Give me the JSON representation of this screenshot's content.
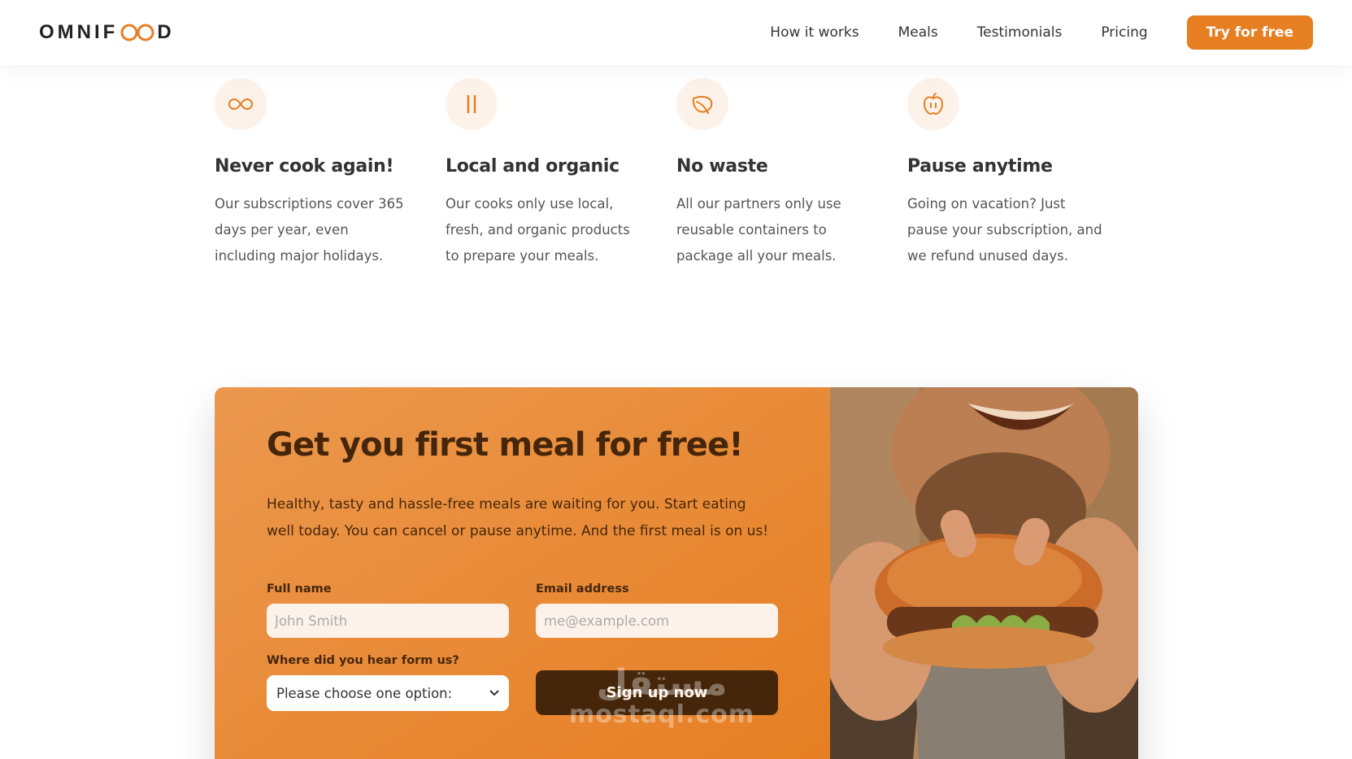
{
  "header": {
    "logo_left": "OMNIF",
    "logo_right": "D",
    "nav": [
      "How it works",
      "Meals",
      "Testimonials",
      "Pricing"
    ],
    "cta_label": "Try for free"
  },
  "colors": {
    "accent": "#e67e22",
    "accent_light": "#fdf2e9",
    "dark_brown": "#45260a"
  },
  "features": [
    {
      "icon": "infinity-icon",
      "title": "Never cook again!",
      "text": "Our subscriptions cover 365 days per year, even including major holidays."
    },
    {
      "icon": "pause-icon",
      "title": "Local and organic",
      "text": "Our cooks only use local, fresh, and organic products to prepare your meals."
    },
    {
      "icon": "leaf-icon",
      "title": "No waste",
      "text": "All our partners only use reusable containers to package all your meals."
    },
    {
      "icon": "apple-icon",
      "title": "Pause anytime",
      "text": "Going on vacation? Just pause your subscription, and we refund unused days."
    }
  ],
  "cta": {
    "heading": "Get you first meal for free!",
    "text": "Healthy, tasty and hassle-free meals are waiting for you. Start eating well today. You can cancel or pause anytime. And the first meal is on us!",
    "form": {
      "full_name_label": "Full name",
      "full_name_placeholder": "John Smith",
      "email_label": "Email address",
      "email_placeholder": "me@example.com",
      "source_label": "Where did you hear form us?",
      "source_selected": "Please choose one option:",
      "submit_label": "Sign up now"
    }
  },
  "watermark": {
    "line1": "مستقل",
    "line2": "mostaql.com"
  }
}
